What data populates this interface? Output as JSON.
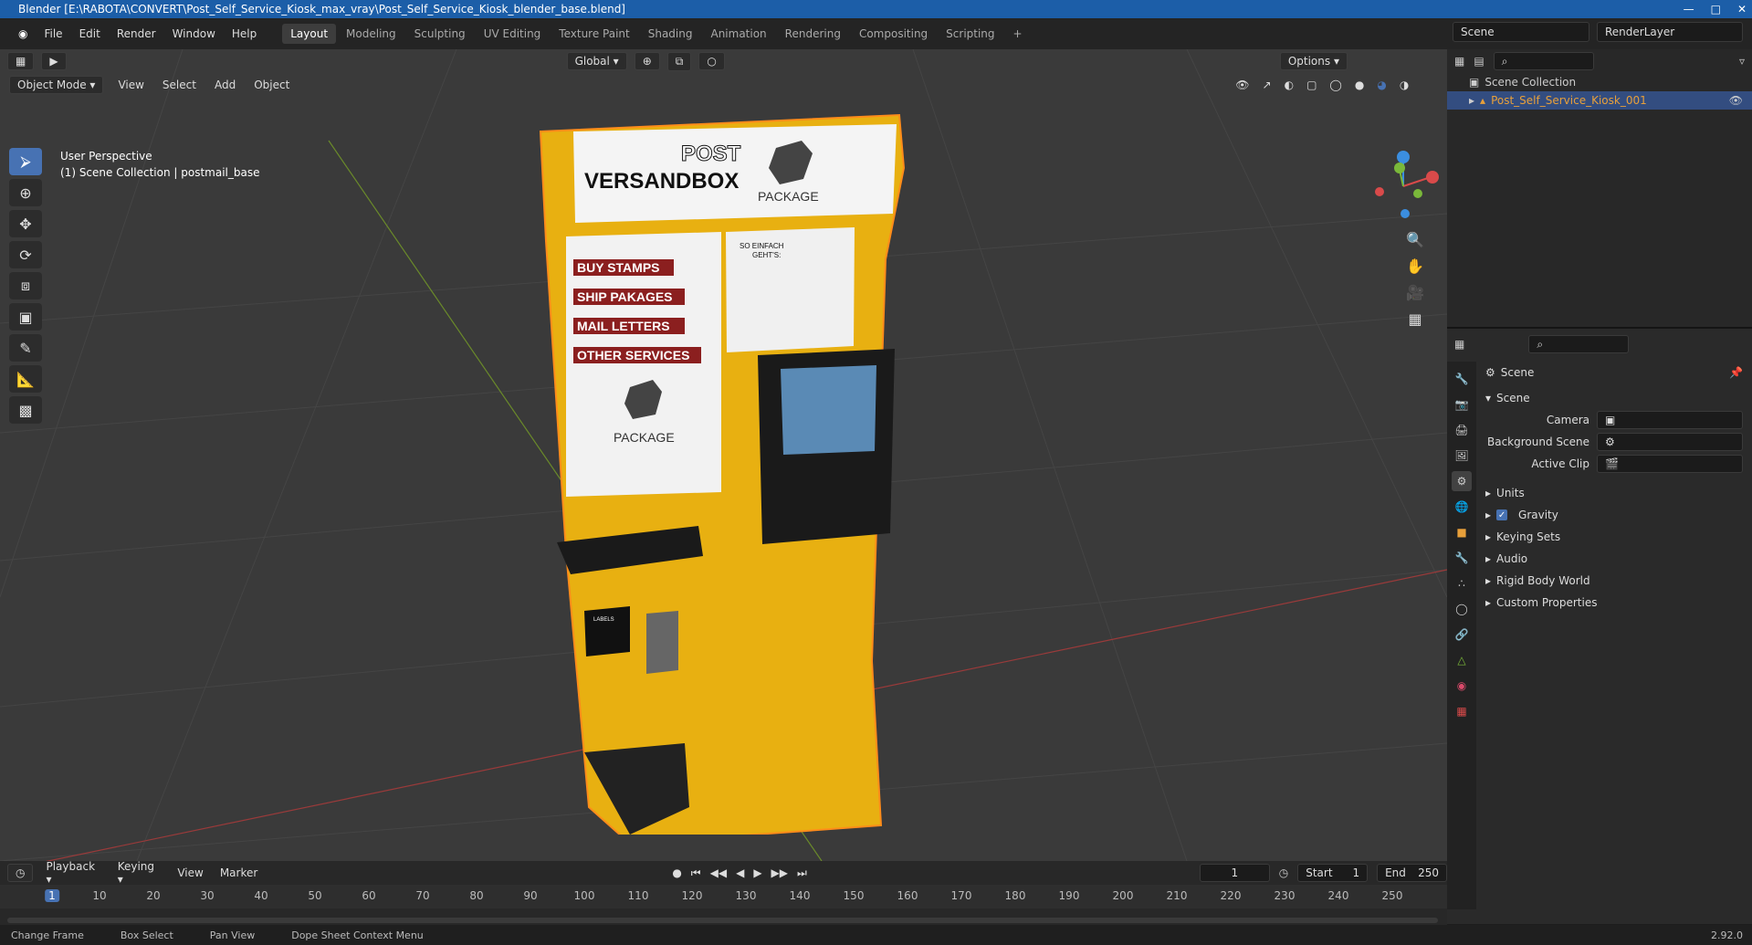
{
  "titlebar": {
    "title": "Blender [E:\\RABOTA\\CONVERT\\Post_Self_Service_Kiosk_max_vray\\Post_Self_Service_Kiosk_blender_base.blend]"
  },
  "menu": {
    "file": "File",
    "edit": "Edit",
    "render": "Render",
    "window": "Window",
    "help": "Help"
  },
  "workspaces": [
    "Layout",
    "Modeling",
    "Sculpting",
    "UV Editing",
    "Texture Paint",
    "Shading",
    "Animation",
    "Rendering",
    "Compositing",
    "Scripting"
  ],
  "scene_field": "Scene",
  "renderlayer_field": "RenderLayer",
  "viewport": {
    "orientation": "Global",
    "options": "Options",
    "mode": "Object Mode",
    "view": "View",
    "select": "Select",
    "add": "Add",
    "object": "Object",
    "perspective": "User Perspective",
    "collection_info": "(1) Scene Collection | postmail_base"
  },
  "kiosk": {
    "post": "POST",
    "versandbox": "VERSANDBOX",
    "package": "PACKAGE",
    "services": [
      "BUY STAMPS",
      "SHIP PAKAGES",
      "MAIL LETTERS",
      "OTHER SERVICES"
    ],
    "package2": "PACKAGE",
    "so_einfach": "SO EINFACH",
    "gehts": "GEHT'S:",
    "labels": "LABELS"
  },
  "outliner": {
    "collection": "Scene Collection",
    "object": "Post_Self_Service_Kiosk_001"
  },
  "properties": {
    "header": "Scene",
    "section": "Scene",
    "camera": "Camera",
    "background_scene": "Background Scene",
    "active_clip": "Active Clip",
    "panels": [
      "Units",
      "Gravity",
      "Keying Sets",
      "Audio",
      "Rigid Body World",
      "Custom Properties"
    ]
  },
  "timeline": {
    "playback": "Playback",
    "keying": "Keying",
    "view": "View",
    "marker": "Marker",
    "current_frame": "1",
    "start_label": "Start",
    "start": "1",
    "end_label": "End",
    "end": "250",
    "ticks": [
      "1",
      "10",
      "20",
      "30",
      "40",
      "50",
      "60",
      "70",
      "80",
      "90",
      "100",
      "110",
      "120",
      "130",
      "140",
      "150",
      "160",
      "170",
      "180",
      "190",
      "200",
      "210",
      "220",
      "230",
      "240",
      "250"
    ]
  },
  "status": {
    "change_frame": "Change Frame",
    "box_select": "Box Select",
    "pan_view": "Pan View",
    "context_menu": "Dope Sheet Context Menu",
    "version": "2.92.0"
  },
  "colors": {
    "accent": "#4772b3",
    "kiosk_yellow": "#e8b011",
    "selection": "#ff8c1a"
  }
}
